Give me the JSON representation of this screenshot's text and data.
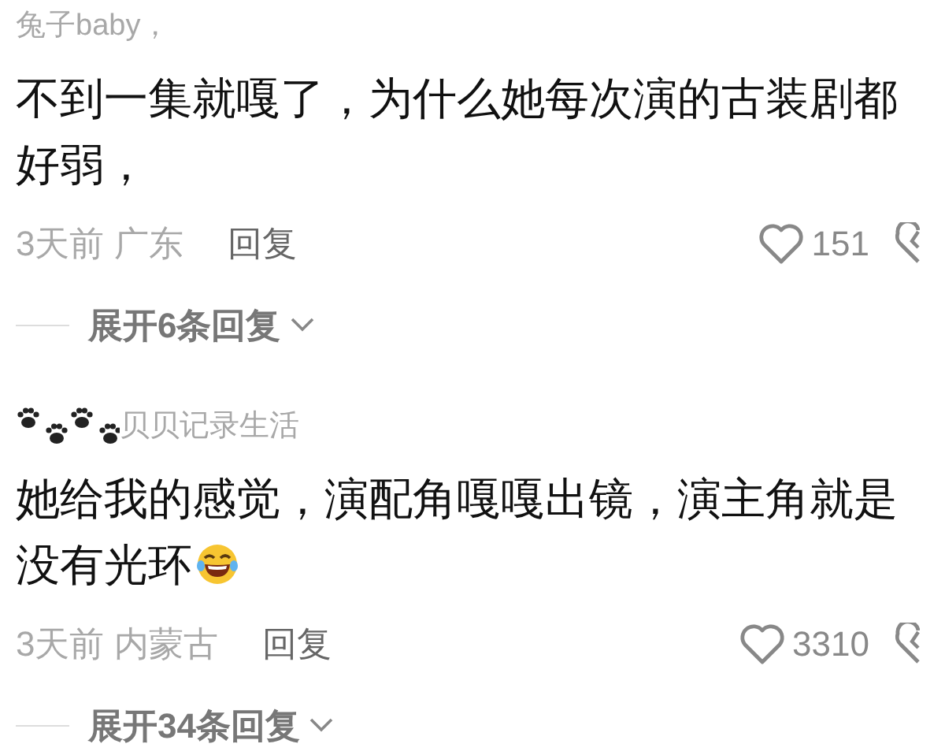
{
  "comments": [
    {
      "username": "兔子baby，",
      "paw_prefix": false,
      "text": "不到一集就嘎了，为什么她每次演的古装剧都好弱，",
      "emoji_suffix": false,
      "time": "3天前",
      "location": "广东",
      "reply_label": "回复",
      "likes": "151",
      "expand_label": "展开6条回复"
    },
    {
      "username": "贝贝记录生活",
      "paw_prefix": true,
      "text": "她给我的感觉，演配角嘎嘎出镜，演主角就是没有光环",
      "emoji_suffix": true,
      "time": "3天前",
      "location": "内蒙古",
      "reply_label": "回复",
      "likes": "3310",
      "expand_label": "展开34条回复"
    }
  ]
}
